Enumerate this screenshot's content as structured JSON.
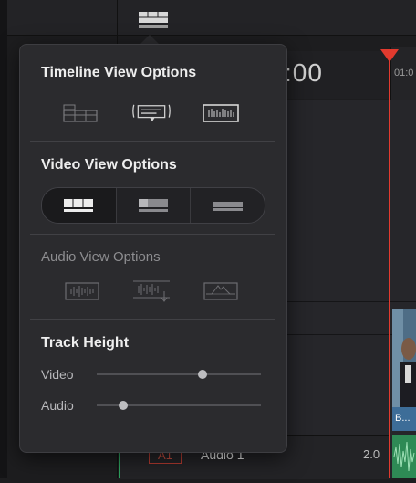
{
  "timeline": {
    "timecode": ":00",
    "ruler_label": "01:0",
    "audio_track": {
      "badge": "A1",
      "name": "Audio 1",
      "channels": "2.0"
    },
    "clip_label": "B..."
  },
  "popover": {
    "timeline_view": {
      "title": "Timeline View Options",
      "options": [
        "stacked-timelines-icon",
        "subtitle-track-icon",
        "audio-waveform-icon"
      ]
    },
    "video_view": {
      "title": "Video View Options",
      "options": [
        "filmstrip-view-icon",
        "thumbnail-view-icon",
        "simple-view-icon"
      ],
      "selected": 0
    },
    "audio_view": {
      "title": "Audio View Options",
      "options": [
        "waveform-view-icon",
        "waveform-overlay-icon",
        "waveform-envelope-icon"
      ]
    },
    "track_height": {
      "title": "Track Height",
      "video_label": "Video",
      "audio_label": "Audio",
      "video_level": 0.65,
      "audio_level": 0.14
    }
  },
  "colors": {
    "playhead": "#e23a2e",
    "accent_audio": "#2ea35f",
    "clip_label": "#3d6d98"
  }
}
